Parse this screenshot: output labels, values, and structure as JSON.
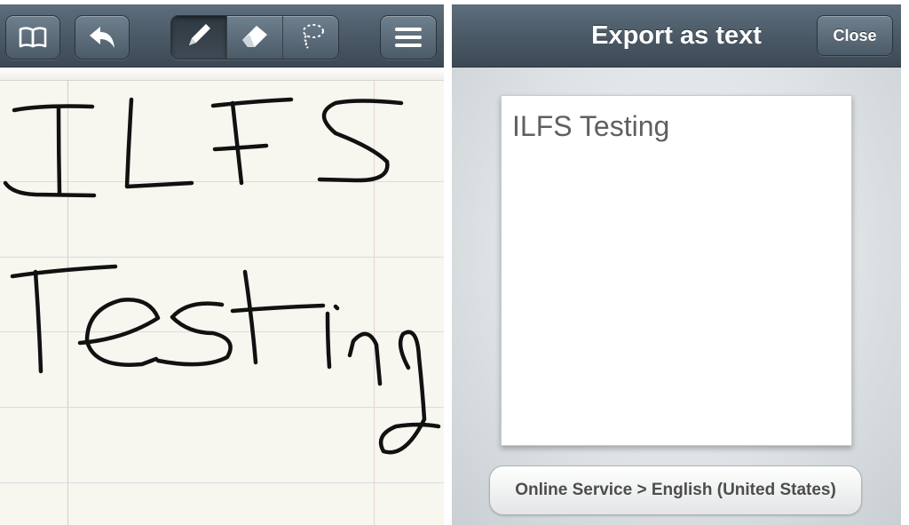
{
  "left_screen": {
    "toolbar": {
      "notebooks_icon": "book-icon",
      "undo_icon": "undo-arrow-icon",
      "tools": [
        {
          "icon": "pen-icon",
          "active": true
        },
        {
          "icon": "eraser-icon",
          "active": false
        },
        {
          "icon": "lasso-icon",
          "active": false
        }
      ],
      "menu_icon": "menu-icon"
    },
    "handwriting": [
      "ILFS",
      "Testing"
    ]
  },
  "right_screen": {
    "title": "Export as text",
    "close_label": "Close",
    "recognized_text": "ILFS Testing",
    "service_label": "Online Service > English (United States)"
  },
  "colors": {
    "toolbar": "#4d5c69",
    "paper": "#f7f6ef",
    "ink": "#111111",
    "margin_line": "#e8c4c4",
    "rule_line": "#d9dde0"
  }
}
